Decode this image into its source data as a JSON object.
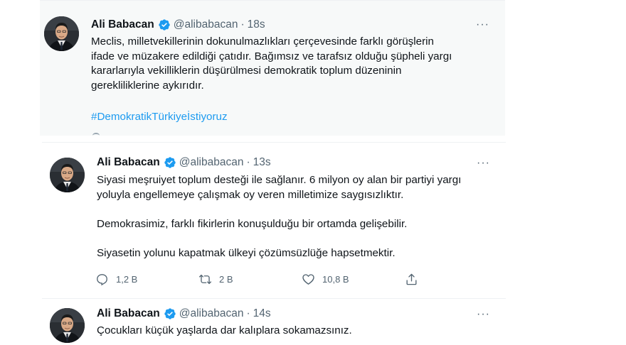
{
  "colors": {
    "text": "#0f1419",
    "muted": "#536471",
    "link": "#1d9bf0",
    "verified": "#1d9bf0",
    "highlight_bg": "#f7f9f9"
  },
  "tweets": [
    {
      "author": "Ali Babacan",
      "verified": true,
      "handle": "@alibabacan",
      "separator": "·",
      "time": "18s",
      "more": "···",
      "lines": [
        "Meclis, milletvekillerinin dokunulmazlıkları çerçevesinde farklı görüşlerin",
        "ifade ve müzakere edildiği çatıdır. Bağımsız ve tarafsız olduğu şüpheli yargı",
        "kararlarıyla vekilliklerin düşürülmesi demokratik toplum düzeninin",
        "gerekliliklerine aykırıdır."
      ],
      "hashtag": "#DemokratikTürkiyeİstiyoruz"
    },
    {
      "author": "Ali Babacan",
      "verified": true,
      "handle": "@alibabacan",
      "separator": "·",
      "time": "13s",
      "more": "···",
      "lines": [
        "Siyasi meşruiyet toplum desteği ile sağlanır. 6 milyon oy alan bir partiyi yargı",
        "yoluyla engellemeye çalışmak oy veren milletimize saygısızlıktır.",
        "Demokrasimiz, farklı fikirlerin konuşulduğu bir ortamda gelişebilir.",
        "Siyasetin yolunu kapatmak ülkeyi çözümsüzlüğe hapsetmektir."
      ],
      "actions": {
        "reply": {
          "icon": "reply-icon",
          "count": "1,2 B"
        },
        "retweet": {
          "icon": "retweet-icon",
          "count": "2 B"
        },
        "like": {
          "icon": "heart-icon",
          "count": "10,8 B"
        },
        "share": {
          "icon": "share-icon"
        }
      }
    },
    {
      "author": "Ali Babacan",
      "verified": true,
      "handle": "@alibabacan",
      "separator": "·",
      "time": "14s",
      "more": "···",
      "lines": [
        "Çocukları küçük yaşlarda dar kalıplara sokamazsınız."
      ]
    }
  ]
}
